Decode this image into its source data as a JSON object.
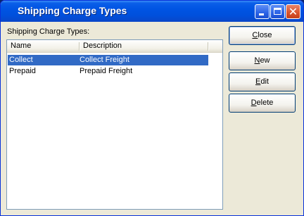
{
  "window": {
    "title": "Shipping Charge Types"
  },
  "list": {
    "label": "Shipping Charge Types:",
    "columns": [
      "Name",
      "Description"
    ],
    "rows": [
      {
        "name": "Collect",
        "description": "Collect Freight",
        "selected": true
      },
      {
        "name": "Prepaid",
        "description": "Prepaid Freight",
        "selected": false
      }
    ]
  },
  "buttons": {
    "close": {
      "first": "C",
      "rest": "lose"
    },
    "new": {
      "first": "N",
      "rest": "ew"
    },
    "edit": {
      "first": "E",
      "rest": "dit"
    },
    "delete": {
      "first": "D",
      "rest": "elete"
    }
  },
  "colors": {
    "titlebar": "#0054e3",
    "selection": "#316ac5",
    "window_bg": "#ece9d8"
  }
}
